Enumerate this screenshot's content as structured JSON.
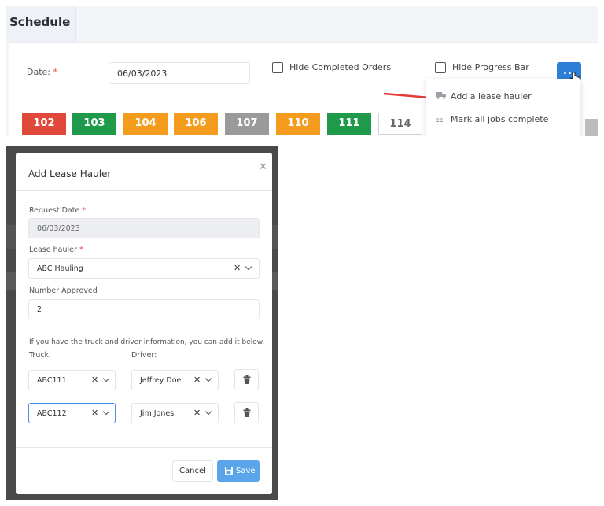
{
  "page": {
    "title": "Schedule"
  },
  "filters": {
    "date_label": "Date:",
    "date_value": "06/03/2023",
    "hide_completed_label": "Hide Completed Orders",
    "hide_progress_label": "Hide Progress Bar",
    "more_label": "..."
  },
  "menu": {
    "items": [
      {
        "label": "Add a lease hauler",
        "icon": "truck-icon"
      },
      {
        "label": "Mark all jobs complete",
        "icon": "checklist-icon"
      }
    ]
  },
  "trucks": [
    {
      "number": "102",
      "color": "#e0483a"
    },
    {
      "number": "103",
      "color": "#1f9a4b"
    },
    {
      "number": "104",
      "color": "#f39c1e"
    },
    {
      "number": "106",
      "color": "#f39c1e"
    },
    {
      "number": "107",
      "color": "#9a9a9a"
    },
    {
      "number": "110",
      "color": "#f39c1e"
    },
    {
      "number": "111",
      "color": "#1f9a4b"
    },
    {
      "number": "114",
      "color": "#ffffff"
    }
  ],
  "modal": {
    "title": "Add Lease Hauler",
    "request_date_label": "Request Date",
    "request_date_value": "06/03/2023",
    "lease_hauler_label": "Lease hauler",
    "lease_hauler_value": "ABC Hauling",
    "number_approved_label": "Number Approved",
    "number_approved_value": "2",
    "info_text": "If you have the truck and driver information, you can add it below.",
    "truck_label": "Truck:",
    "driver_label": "Driver:",
    "rows": [
      {
        "truck": "ABC111",
        "driver": "Jeffrey Doe"
      },
      {
        "truck": "ABC112",
        "driver": "Jim Jones"
      }
    ],
    "cancel_label": "Cancel",
    "save_label": "Save"
  }
}
